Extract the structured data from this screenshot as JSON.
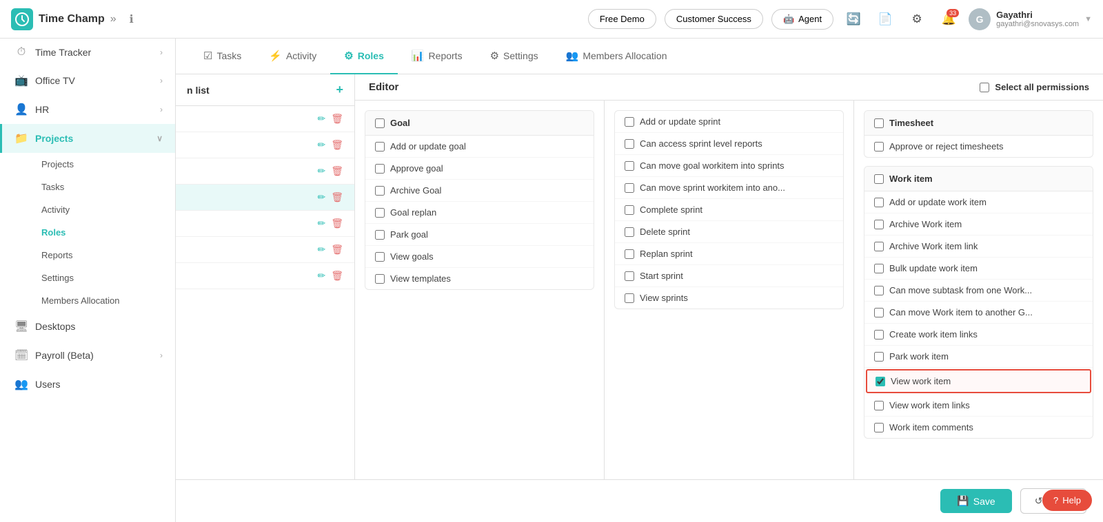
{
  "topNav": {
    "logo": "TC",
    "logoText": "Time Champ",
    "freeDemoLabel": "Free Demo",
    "customerSuccessLabel": "Customer Success",
    "agentLabel": "Agent",
    "notificationCount": "33",
    "userName": "Gayathri",
    "userEmail": "gayathri@snovasys.com"
  },
  "sidebar": {
    "items": [
      {
        "id": "time-tracker",
        "icon": "⏱",
        "label": "Time Tracker",
        "hasArrow": true
      },
      {
        "id": "office-tv",
        "icon": "📺",
        "label": "Office TV",
        "hasArrow": true
      },
      {
        "id": "hr",
        "icon": "👤",
        "label": "HR",
        "hasArrow": true
      },
      {
        "id": "projects",
        "icon": "📁",
        "label": "Projects",
        "hasArrow": true,
        "active": true,
        "expanded": true
      }
    ],
    "projectSubItems": [
      {
        "id": "projects-sub",
        "label": "Projects"
      },
      {
        "id": "tasks-sub",
        "label": "Tasks"
      },
      {
        "id": "activity-sub",
        "label": "Activity"
      },
      {
        "id": "roles-sub",
        "label": "Roles",
        "active": true
      },
      {
        "id": "reports-sub",
        "label": "Reports"
      },
      {
        "id": "settings-sub",
        "label": "Settings"
      },
      {
        "id": "members-sub",
        "label": "Members Allocation"
      }
    ],
    "bottomItems": [
      {
        "id": "desktops",
        "icon": "🖥",
        "label": "Desktops"
      },
      {
        "id": "payroll",
        "icon": "🗓",
        "label": "Payroll (Beta)",
        "hasArrow": true
      },
      {
        "id": "users",
        "icon": "👥",
        "label": "Users"
      }
    ]
  },
  "tabs": [
    {
      "id": "tasks",
      "icon": "☑",
      "label": "Tasks"
    },
    {
      "id": "activity",
      "icon": "⚡",
      "label": "Activity"
    },
    {
      "id": "roles",
      "icon": "⚙",
      "label": "Roles",
      "active": true
    },
    {
      "id": "reports",
      "icon": "📊",
      "label": "Reports"
    },
    {
      "id": "settings",
      "icon": "⚙",
      "label": "Settings"
    },
    {
      "id": "members",
      "icon": "👥",
      "label": "Members Allocation"
    }
  ],
  "rolesPanel": {
    "headerLabel": "n list",
    "editorLabel": "Editor",
    "selectAllLabel": "Select all permissions",
    "items": [
      {
        "id": 1
      },
      {
        "id": 2
      },
      {
        "id": 3
      },
      {
        "id": 4
      },
      {
        "id": 5
      },
      {
        "id": 6
      },
      {
        "id": 7
      }
    ]
  },
  "goalSection": {
    "title": "Goal",
    "items": [
      "Add or update goal",
      "Approve goal",
      "Archive Goal",
      "Goal replan",
      "Park goal",
      "View goals",
      "View templates"
    ]
  },
  "sprintSection": {
    "items": [
      "Add or update sprint",
      "Can access sprint level reports",
      "Can move goal workitem into sprints",
      "Can move sprint workitem into ano...",
      "Complete sprint",
      "Delete sprint",
      "Replan sprint",
      "Start sprint",
      "View sprints"
    ]
  },
  "timesheetSection": {
    "title": "Timesheet",
    "items": [
      "Approve or reject timesheets"
    ]
  },
  "workItemSection": {
    "title": "Work item",
    "items": [
      {
        "label": "Add or update work item",
        "checked": false
      },
      {
        "label": "Archive Work item",
        "checked": false
      },
      {
        "label": "Archive Work item link",
        "checked": false
      },
      {
        "label": "Bulk update work item",
        "checked": false
      },
      {
        "label": "Can move subtask from one Work...",
        "checked": false
      },
      {
        "label": "Can move Work item to another G...",
        "checked": false
      },
      {
        "label": "Create work item links",
        "checked": false
      },
      {
        "label": "Park work item",
        "checked": false
      },
      {
        "label": "View work item",
        "checked": true,
        "highlighted": true
      },
      {
        "label": "View work item links",
        "checked": false
      },
      {
        "label": "Work item comments",
        "checked": false
      }
    ]
  },
  "actions": {
    "saveLabel": "Save",
    "resetLabel": "Reset",
    "helpLabel": "Help"
  }
}
